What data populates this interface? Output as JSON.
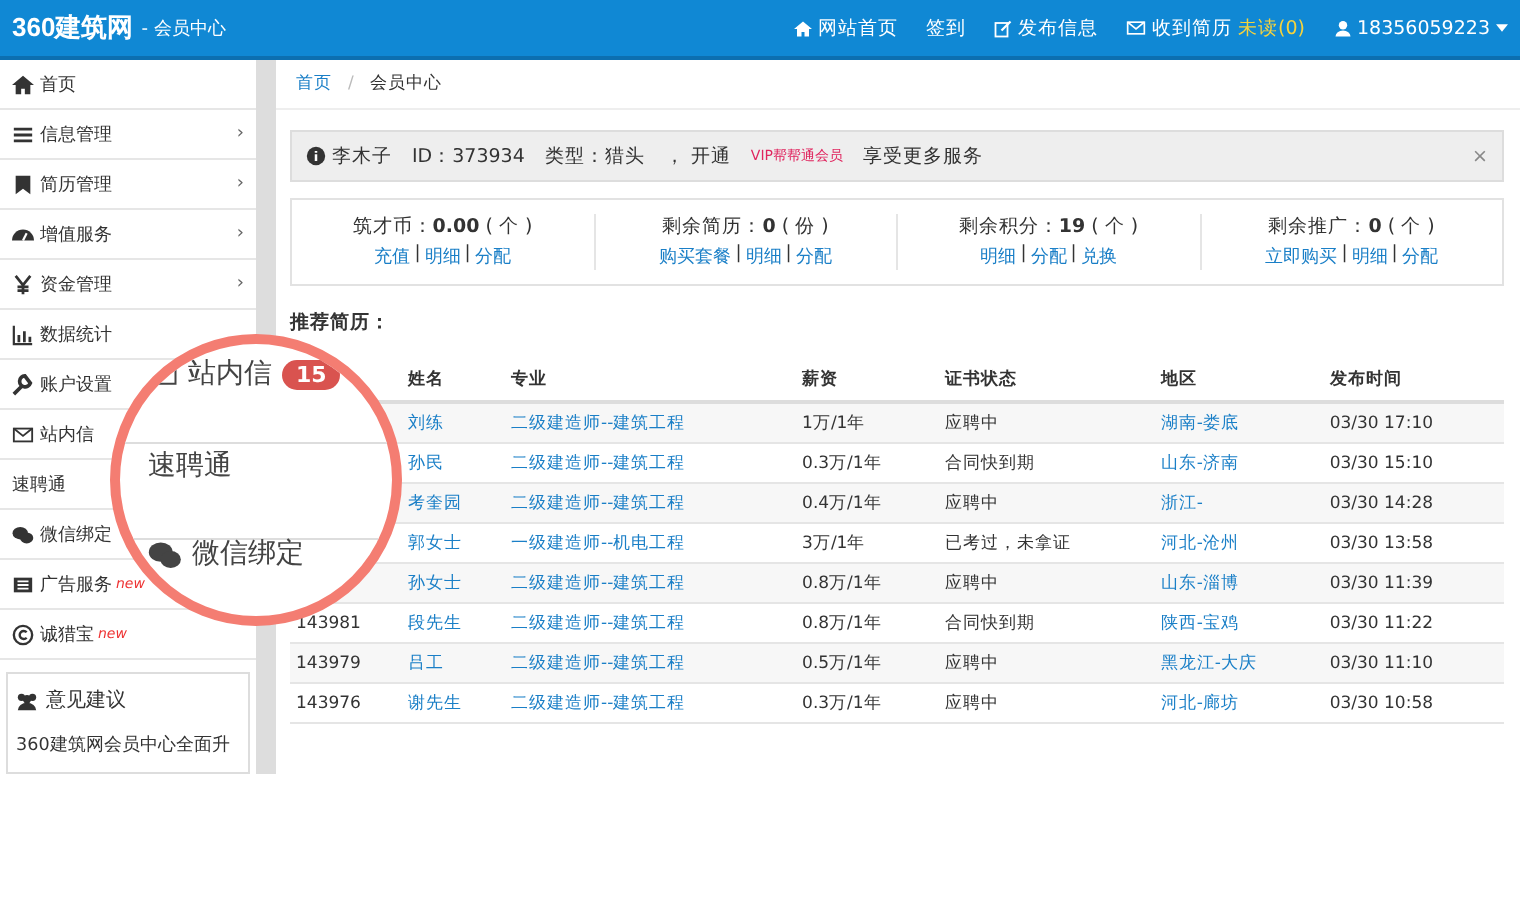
{
  "topbar": {
    "logo": "360建筑网",
    "subtitle": "- 会员中心",
    "links": [
      {
        "label": "网站首页"
      },
      {
        "label": "签到"
      },
      {
        "label": "发布信息"
      },
      {
        "label": "收到简历",
        "highlight": "未读(0)"
      }
    ],
    "user": "18356059223"
  },
  "sidebar": {
    "items": [
      {
        "label": "首页"
      },
      {
        "label": "信息管理",
        "chevron": "›"
      },
      {
        "label": "简历管理",
        "chevron": "›"
      },
      {
        "label": "增值服务",
        "chevron": "›"
      },
      {
        "label": "资金管理",
        "chevron": "›"
      },
      {
        "label": "数据统计"
      },
      {
        "label": "账户设置"
      },
      {
        "label": "站内信"
      },
      {
        "label": "速聘通"
      },
      {
        "label": "微信绑定"
      },
      {
        "label": "广告服务",
        "badge": "new"
      },
      {
        "label": "诚猎宝",
        "badge": "new"
      }
    ],
    "feedback": {
      "title": "意见建议",
      "text": "360建筑网会员中心全面升"
    }
  },
  "breadcrumb": [
    {
      "label": "首页"
    },
    {
      "label": "/"
    },
    {
      "label": "会员中心"
    }
  ],
  "alert": {
    "name": "李木子",
    "id": "ID：373934",
    "type": "类型：猎头",
    "open": "，  开通",
    "vip": "VIP帮帮通会员",
    "tail": "享受更多服务",
    "close": "×"
  },
  "stats": [
    {
      "label": "筑才币：",
      "value": "0.00",
      "unit": "( 个 )",
      "links": [
        "充值",
        "|",
        "明细",
        "|",
        "分配"
      ]
    },
    {
      "label": "剩余简历：",
      "value": "0",
      "unit": "( 份 )",
      "links": [
        "购买套餐",
        "|",
        "明细",
        "|",
        "分配"
      ]
    },
    {
      "label": "剩余积分：",
      "value": "19",
      "unit": "( 个 )",
      "links": [
        "明细",
        "|",
        "分配",
        "|",
        "兑换"
      ]
    },
    {
      "label": "剩余推广：",
      "value": "0",
      "unit": "( 个 )",
      "links": [
        "立即购买",
        "|",
        "明细",
        "|",
        "分配"
      ]
    }
  ],
  "recommend_title": "推荐简历：",
  "table": {
    "columns": [
      "姓名",
      "专业",
      "薪资",
      "证书状态",
      "地区",
      "发布时间"
    ],
    "rows": [
      {
        "name": "刘练",
        "major": "二级建造师--建筑工程",
        "salary": "1万/1年",
        "status": "应聘中",
        "region": "湖南-娄底",
        "time": "03/30 17:10"
      },
      {
        "name": "孙民",
        "major": "二级建造师--建筑工程",
        "salary": "0.3万/1年",
        "status": "合同快到期",
        "region": "山东-济南",
        "time": "03/30 15:10"
      },
      {
        "name": "考奎园",
        "major": "二级建造师--建筑工程",
        "salary": "0.4万/1年",
        "status": "应聘中",
        "region": "浙江-",
        "time": "03/30 14:28"
      },
      {
        "name": "郭女士",
        "major": "一级建造师--机电工程",
        "salary": "3万/1年",
        "status": "已考过，未拿证",
        "region": "河北-沧州",
        "time": "03/30 13:58"
      },
      {
        "name": "孙女士",
        "major": "二级建造师--建筑工程",
        "salary": "0.8万/1年",
        "status": "应聘中",
        "region": "山东-淄博",
        "time": "03/30 11:39"
      },
      {
        "id": "143981",
        "name": "段先生",
        "major": "二级建造师--建筑工程",
        "salary": "0.8万/1年",
        "status": "合同快到期",
        "region": "陕西-宝鸡",
        "time": "03/30 11:22"
      },
      {
        "id": "143979",
        "name": "吕工",
        "major": "二级建造师--建筑工程",
        "salary": "0.5万/1年",
        "status": "应聘中",
        "region": "黑龙江-大庆",
        "time": "03/30 11:10"
      },
      {
        "id": "143976",
        "name": "谢先生",
        "major": "二级建造师--建筑工程",
        "salary": "0.3万/1年",
        "status": "应聘中",
        "region": "河北-廊坊",
        "time": "03/30 10:58"
      }
    ]
  },
  "magnifier": {
    "items": [
      {
        "kind": "mail",
        "label": "站内信",
        "badge": "15"
      },
      {
        "kind": "plain",
        "label": "速聘通"
      },
      {
        "kind": "wechat",
        "label": "微信绑定"
      }
    ]
  }
}
